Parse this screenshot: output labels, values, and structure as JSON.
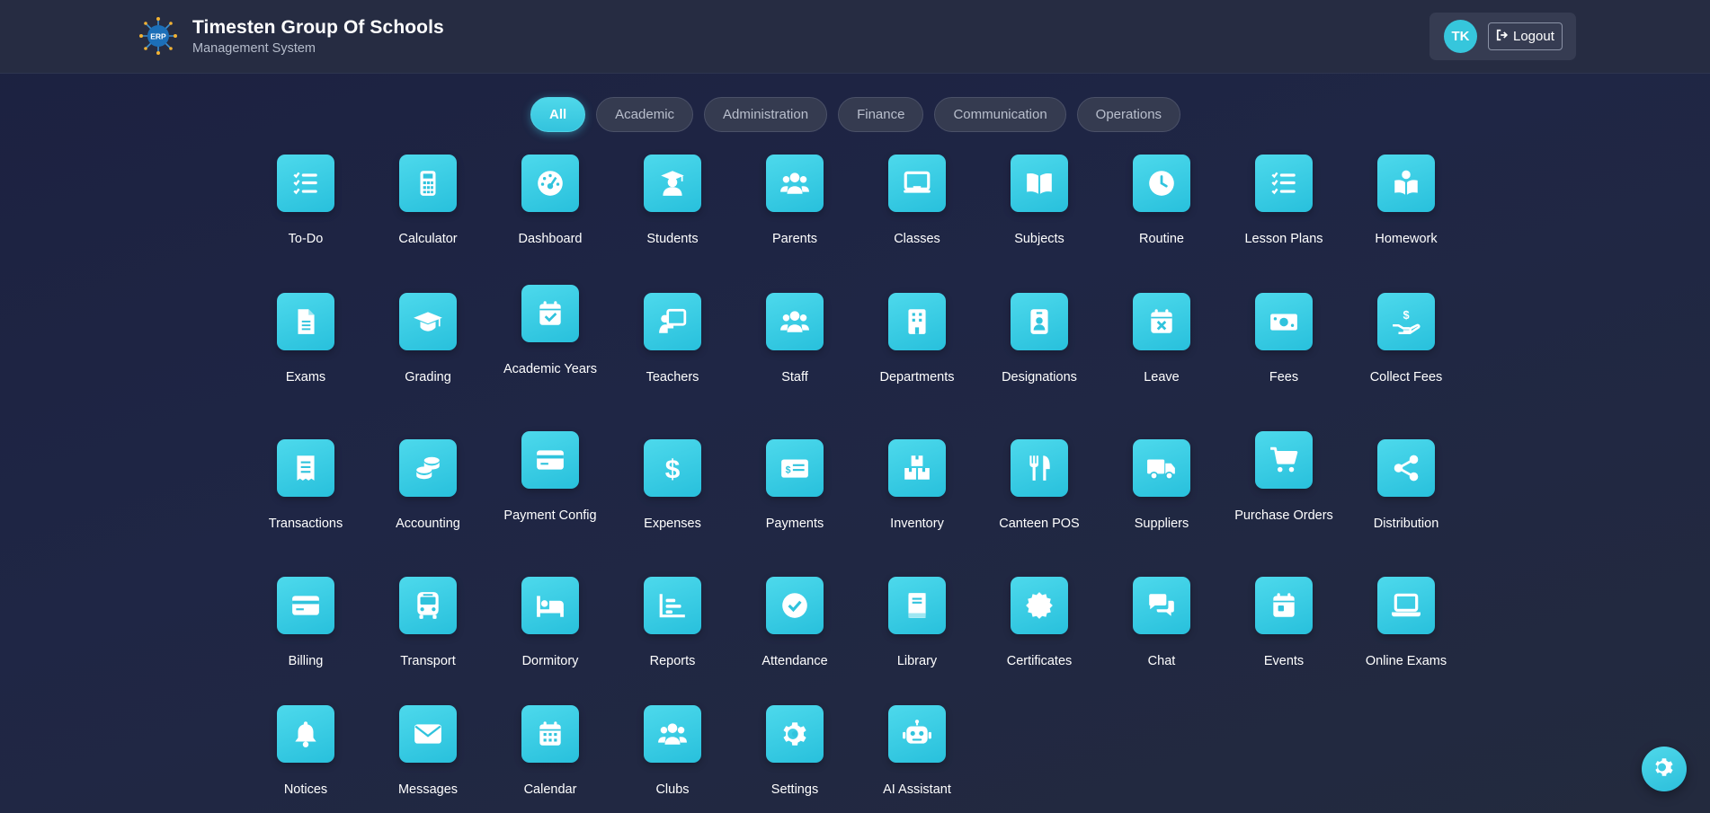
{
  "header": {
    "title": "Timesten Group Of Schools",
    "subtitle": "Management System",
    "logo_text": "ERP",
    "avatar_initials": "TK",
    "logout_label": "Logout"
  },
  "filters": [
    {
      "label": "All",
      "active": true
    },
    {
      "label": "Academic",
      "active": false
    },
    {
      "label": "Administration",
      "active": false
    },
    {
      "label": "Finance",
      "active": false
    },
    {
      "label": "Communication",
      "active": false
    },
    {
      "label": "Operations",
      "active": false
    }
  ],
  "apps": [
    {
      "label": "To-Do",
      "icon": "list-check-icon"
    },
    {
      "label": "Calculator",
      "icon": "calculator-icon"
    },
    {
      "label": "Dashboard",
      "icon": "gauge-icon"
    },
    {
      "label": "Students",
      "icon": "graduate-icon"
    },
    {
      "label": "Parents",
      "icon": "users-icon"
    },
    {
      "label": "Classes",
      "icon": "chalkboard-icon"
    },
    {
      "label": "Subjects",
      "icon": "book-open-icon"
    },
    {
      "label": "Routine",
      "icon": "clock-icon"
    },
    {
      "label": "Lesson Plans",
      "icon": "list-check-icon"
    },
    {
      "label": "Homework",
      "icon": "book-reader-icon"
    },
    {
      "label": "Exams",
      "icon": "file-icon"
    },
    {
      "label": "Grading",
      "icon": "graduation-cap-icon"
    },
    {
      "label": "Academic Years",
      "icon": "calendar-check-icon"
    },
    {
      "label": "Teachers",
      "icon": "chalkboard-teacher-icon"
    },
    {
      "label": "Staff",
      "icon": "users-icon"
    },
    {
      "label": "Departments",
      "icon": "building-icon"
    },
    {
      "label": "Designations",
      "icon": "id-badge-icon"
    },
    {
      "label": "Leave",
      "icon": "calendar-times-icon"
    },
    {
      "label": "Fees",
      "icon": "money-bill-icon"
    },
    {
      "label": "Collect Fees",
      "icon": "hand-dollar-icon"
    },
    {
      "label": "Transactions",
      "icon": "receipt-icon"
    },
    {
      "label": "Accounting",
      "icon": "coins-icon"
    },
    {
      "label": "Payment Config",
      "icon": "credit-card-icon"
    },
    {
      "label": "Expenses",
      "icon": "dollar-icon"
    },
    {
      "label": "Payments",
      "icon": "money-check-icon"
    },
    {
      "label": "Inventory",
      "icon": "boxes-icon"
    },
    {
      "label": "Canteen POS",
      "icon": "utensils-icon"
    },
    {
      "label": "Suppliers",
      "icon": "truck-icon"
    },
    {
      "label": "Purchase Orders",
      "icon": "cart-icon"
    },
    {
      "label": "Distribution",
      "icon": "share-icon"
    },
    {
      "label": "Billing",
      "icon": "credit-card-icon"
    },
    {
      "label": "Transport",
      "icon": "bus-icon"
    },
    {
      "label": "Dormitory",
      "icon": "bed-icon"
    },
    {
      "label": "Reports",
      "icon": "chart-bar-icon"
    },
    {
      "label": "Attendance",
      "icon": "check-circle-icon"
    },
    {
      "label": "Library",
      "icon": "book-icon"
    },
    {
      "label": "Certificates",
      "icon": "certificate-icon"
    },
    {
      "label": "Chat",
      "icon": "comments-icon"
    },
    {
      "label": "Events",
      "icon": "calendar-day-icon"
    },
    {
      "label": "Online Exams",
      "icon": "laptop-icon"
    },
    {
      "label": "Notices",
      "icon": "bell-icon"
    },
    {
      "label": "Messages",
      "icon": "envelope-icon"
    },
    {
      "label": "Calendar",
      "icon": "calendar-alt-icon"
    },
    {
      "label": "Clubs",
      "icon": "users-icon"
    },
    {
      "label": "Settings",
      "icon": "gear-icon"
    },
    {
      "label": "AI Assistant",
      "icon": "robot-icon"
    }
  ],
  "fab": {
    "icon": "gear-icon"
  },
  "colors": {
    "accent": "#36c6dc",
    "background": "#1f2645",
    "topbar": "#262c42"
  }
}
